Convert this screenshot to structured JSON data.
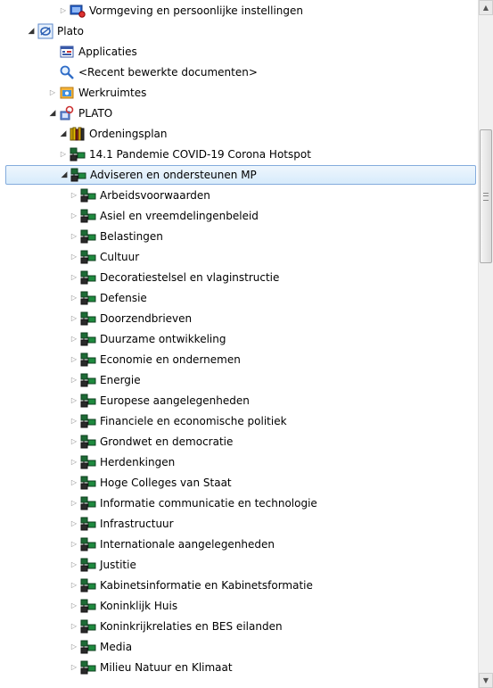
{
  "tree": {
    "items": [
      {
        "label": "Vormgeving en persoonlijke instellingen",
        "level": 1,
        "expanded": false,
        "icon": "settings-icon"
      },
      {
        "label": "Plato",
        "level": 0,
        "expanded": true,
        "icon": "plato-app-icon"
      },
      {
        "label": "Applicaties",
        "level": 1,
        "expanded": null,
        "icon": "applications-icon"
      },
      {
        "label": "<Recent bewerkte documenten>",
        "level": 1,
        "expanded": null,
        "icon": "search-icon"
      },
      {
        "label": "Werkruimtes",
        "level": 1,
        "expanded": false,
        "icon": "workspaces-icon"
      },
      {
        "label": "PLATO",
        "level": 1,
        "expanded": true,
        "icon": "plato-search-icon"
      },
      {
        "label": "Ordeningsplan",
        "level": 2,
        "expanded": true,
        "icon": "books-icon"
      },
      {
        "label": "14.1 Pandemie COVID-19 Corona Hotspot",
        "level": 3,
        "expanded": false,
        "icon": "folder-tree-icon"
      },
      {
        "label": "Adviseren en ondersteunen MP",
        "level": 3,
        "expanded": true,
        "icon": "folder-tree-icon",
        "selected": true
      },
      {
        "label": "Arbeidsvoorwaarden",
        "level": 4,
        "expanded": false,
        "icon": "folder-tree-icon"
      },
      {
        "label": "Asiel en vreemdelingenbeleid",
        "level": 4,
        "expanded": false,
        "icon": "folder-tree-icon"
      },
      {
        "label": "Belastingen",
        "level": 4,
        "expanded": false,
        "icon": "folder-tree-icon"
      },
      {
        "label": "Cultuur",
        "level": 4,
        "expanded": false,
        "icon": "folder-tree-icon"
      },
      {
        "label": "Decoratiestelsel en vlaginstructie",
        "level": 4,
        "expanded": false,
        "icon": "folder-tree-icon"
      },
      {
        "label": "Defensie",
        "level": 4,
        "expanded": false,
        "icon": "folder-tree-icon"
      },
      {
        "label": "Doorzendbrieven",
        "level": 4,
        "expanded": false,
        "icon": "folder-tree-icon"
      },
      {
        "label": "Duurzame ontwikkeling",
        "level": 4,
        "expanded": false,
        "icon": "folder-tree-icon"
      },
      {
        "label": "Economie en ondernemen",
        "level": 4,
        "expanded": false,
        "icon": "folder-tree-icon"
      },
      {
        "label": "Energie",
        "level": 4,
        "expanded": false,
        "icon": "folder-tree-icon"
      },
      {
        "label": "Europese aangelegenheden",
        "level": 4,
        "expanded": false,
        "icon": "folder-tree-icon"
      },
      {
        "label": "Financiele en economische politiek",
        "level": 4,
        "expanded": false,
        "icon": "folder-tree-icon"
      },
      {
        "label": "Grondwet en democratie",
        "level": 4,
        "expanded": false,
        "icon": "folder-tree-icon"
      },
      {
        "label": "Herdenkingen",
        "level": 4,
        "expanded": false,
        "icon": "folder-tree-icon"
      },
      {
        "label": "Hoge Colleges van Staat",
        "level": 4,
        "expanded": false,
        "icon": "folder-tree-icon"
      },
      {
        "label": "Informatie communicatie en technologie",
        "level": 4,
        "expanded": false,
        "icon": "folder-tree-icon"
      },
      {
        "label": "Infrastructuur",
        "level": 4,
        "expanded": false,
        "icon": "folder-tree-icon"
      },
      {
        "label": "Internationale aangelegenheden",
        "level": 4,
        "expanded": false,
        "icon": "folder-tree-icon"
      },
      {
        "label": "Justitie",
        "level": 4,
        "expanded": false,
        "icon": "folder-tree-icon"
      },
      {
        "label": "Kabinetsinformatie en Kabinetsformatie",
        "level": 4,
        "expanded": false,
        "icon": "folder-tree-icon"
      },
      {
        "label": "Koninklijk Huis",
        "level": 4,
        "expanded": false,
        "icon": "folder-tree-icon"
      },
      {
        "label": "Koninkrijkrelaties en BES eilanden",
        "level": 4,
        "expanded": false,
        "icon": "folder-tree-icon"
      },
      {
        "label": "Media",
        "level": 4,
        "expanded": false,
        "icon": "folder-tree-icon"
      },
      {
        "label": "Milieu Natuur en Klimaat",
        "level": 4,
        "expanded": false,
        "icon": "folder-tree-icon"
      }
    ]
  },
  "colors": {
    "selection_bg": "#d7ebfb",
    "selection_border": "#84acdd",
    "folder_green": "#1e8a3e",
    "folder_dark": "#2a2a2a"
  },
  "scrollbar": {
    "up_icon": "scroll-up-arrow-icon",
    "down_icon": "scroll-down-arrow-icon"
  }
}
